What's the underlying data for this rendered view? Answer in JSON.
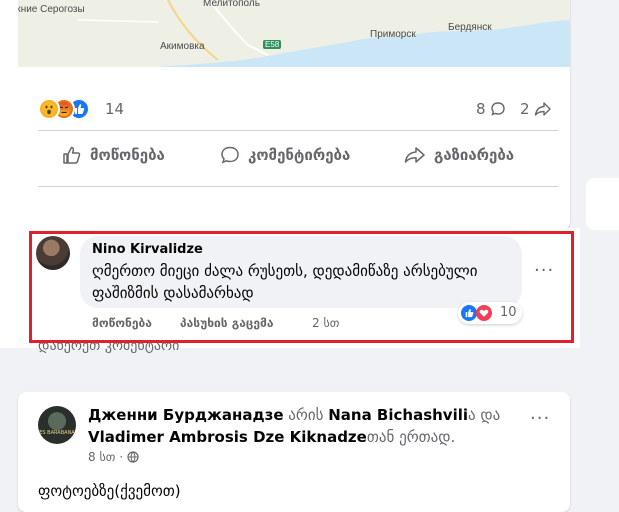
{
  "map": {
    "labels": [
      "жние Серогозы",
      "Мелитополь",
      "Акимовка",
      "Приморск",
      "Бердянск"
    ],
    "road": "E58"
  },
  "post": {
    "reaction_count": "14",
    "comments_count": "8",
    "shares_count": "2",
    "actions": {
      "like": "მოწონება",
      "comment": "კომენტირება",
      "share": "გაზიარება"
    }
  },
  "comment": {
    "author": "Nino Kirvalidze",
    "text": "ღმერთო მიეცი ძალა რუსეთს, დედამიწაზე არსებული ფაშიზმის დასამარხად",
    "reaction_count": "10",
    "like_label": "მოწონება",
    "reply_label": "პასუხის გაცემა",
    "time": "2 სთ",
    "more": "···"
  },
  "write_comment": "დაწერეთ კომენტარი",
  "post2": {
    "author": "Дженни Бурджанадзе",
    "connector1": " არის ",
    "with1": "Nana Bichashvili",
    "connector2": "ა და ",
    "with2": "Vladimer Ambrosis Dze Kiknadze",
    "connector3": "თან ერთად.",
    "time": "8 სთ",
    "separator": "·",
    "text": "ფოტოებზე(ქვემოთ)",
    "avatar_text": "ES BARABANA",
    "more": "···"
  },
  "colors": {
    "accent_blue": "#1877f2",
    "highlight_red": "#e0202a",
    "muted": "#65676b"
  }
}
